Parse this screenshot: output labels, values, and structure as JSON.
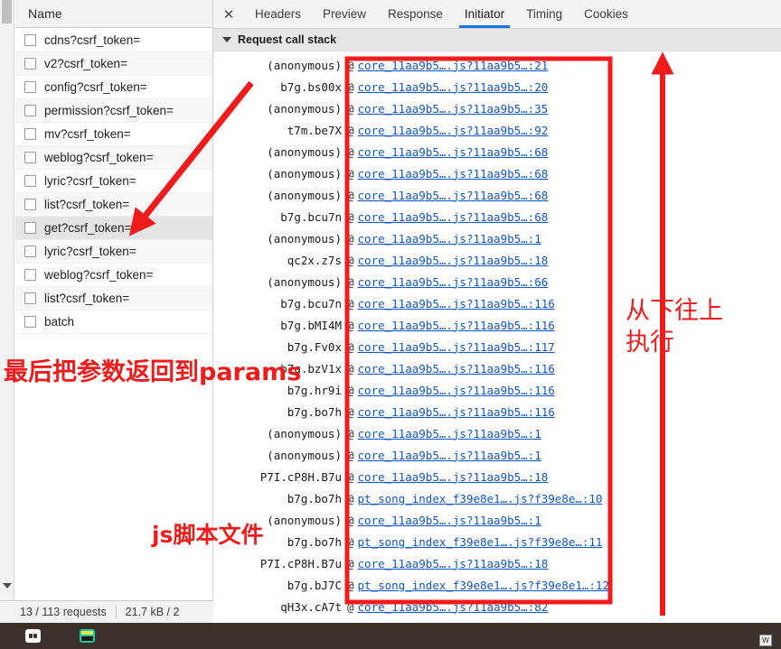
{
  "left_panel": {
    "column_header": "Name",
    "requests": [
      {
        "name": "cdns?csrf_token=",
        "selected": false
      },
      {
        "name": "v2?csrf_token=",
        "selected": false
      },
      {
        "name": "config?csrf_token=",
        "selected": false
      },
      {
        "name": "permission?csrf_token=",
        "selected": false
      },
      {
        "name": "mv?csrf_token=",
        "selected": false
      },
      {
        "name": "weblog?csrf_token=",
        "selected": false
      },
      {
        "name": "lyric?csrf_token=",
        "selected": false
      },
      {
        "name": "list?csrf_token=",
        "selected": false
      },
      {
        "name": "get?csrf_token=",
        "selected": true
      },
      {
        "name": "lyric?csrf_token=",
        "selected": false
      },
      {
        "name": "weblog?csrf_token=",
        "selected": false
      },
      {
        "name": "list?csrf_token=",
        "selected": false
      },
      {
        "name": "batch",
        "selected": false
      }
    ]
  },
  "detail_panel": {
    "close_label": "✕",
    "tabs": [
      {
        "label": "Headers",
        "active": false
      },
      {
        "label": "Preview",
        "active": false
      },
      {
        "label": "Response",
        "active": false
      },
      {
        "label": "Initiator",
        "active": true
      },
      {
        "label": "Timing",
        "active": false
      },
      {
        "label": "Cookies",
        "active": false
      }
    ],
    "section_title": "Request call stack",
    "at_symbol": "@",
    "call_stack": [
      {
        "fn": "(anonymous)",
        "link": "core_11aa9b5….js?11aa9b5…:21"
      },
      {
        "fn": "b7g.bs00x",
        "link": "core_11aa9b5….js?11aa9b5…:20"
      },
      {
        "fn": "(anonymous)",
        "link": "core_11aa9b5….js?11aa9b5…:35"
      },
      {
        "fn": "t7m.be7X",
        "link": "core_11aa9b5….js?11aa9b5…:92"
      },
      {
        "fn": "(anonymous)",
        "link": "core_11aa9b5….js?11aa9b5…:68"
      },
      {
        "fn": "(anonymous)",
        "link": "core_11aa9b5….js?11aa9b5…:68"
      },
      {
        "fn": "(anonymous)",
        "link": "core_11aa9b5….js?11aa9b5…:68"
      },
      {
        "fn": "b7g.bcu7n",
        "link": "core_11aa9b5….js?11aa9b5…:68"
      },
      {
        "fn": "(anonymous)",
        "link": "core_11aa9b5….js?11aa9b5…:1"
      },
      {
        "fn": "qc2x.z7s",
        "link": "core_11aa9b5….js?11aa9b5…:18"
      },
      {
        "fn": "(anonymous)",
        "link": "core_11aa9b5….js?11aa9b5…:66"
      },
      {
        "fn": "b7g.bcu7n",
        "link": "core_11aa9b5….js?11aa9b5…:116"
      },
      {
        "fn": "b7g.bMI4M",
        "link": "core_11aa9b5….js?11aa9b5…:116"
      },
      {
        "fn": "b7g.Fv0x",
        "link": "core_11aa9b5….js?11aa9b5…:117"
      },
      {
        "fn": "b7g.bzV1x",
        "link": "core_11aa9b5….js?11aa9b5…:116"
      },
      {
        "fn": "b7g.hr9i",
        "link": "core_11aa9b5….js?11aa9b5…:116"
      },
      {
        "fn": "b7g.bo7h",
        "link": "core_11aa9b5….js?11aa9b5…:116"
      },
      {
        "fn": "(anonymous)",
        "link": "core_11aa9b5….js?11aa9b5…:1"
      },
      {
        "fn": "(anonymous)",
        "link": "core_11aa9b5….js?11aa9b5…:1"
      },
      {
        "fn": "P7I.cP8H.B7u",
        "link": "core_11aa9b5….js?11aa9b5…:18"
      },
      {
        "fn": "b7g.bo7h",
        "link": "pt_song_index_f39e8e1….js?f39e8e…:10"
      },
      {
        "fn": "(anonymous)",
        "link": "core_11aa9b5….js?11aa9b5…:1"
      },
      {
        "fn": "b7g.bo7h",
        "link": "pt_song_index_f39e8e1….js?f39e8e…:11"
      },
      {
        "fn": "P7I.cP8H.B7u",
        "link": "core_11aa9b5….js?11aa9b5…:18"
      },
      {
        "fn": "b7g.bJ7C",
        "link": "pt_song_index_f39e8e1….js?f39e8e1…:12"
      },
      {
        "fn": "qH3x.cA7t",
        "link": "core_11aa9b5….js?11aa9b5…:82"
      }
    ]
  },
  "status_bar": {
    "requests": "13 / 113 requests",
    "transferred": "21.7 kB / 2"
  },
  "taskbar": {
    "tray_label": "W"
  },
  "annotations": {
    "params_note": "最后把参数返回到params",
    "js_file_note": "js脚本文件",
    "bottom_up_note": "从下往上\n执行",
    "color": "#f01b1b"
  }
}
